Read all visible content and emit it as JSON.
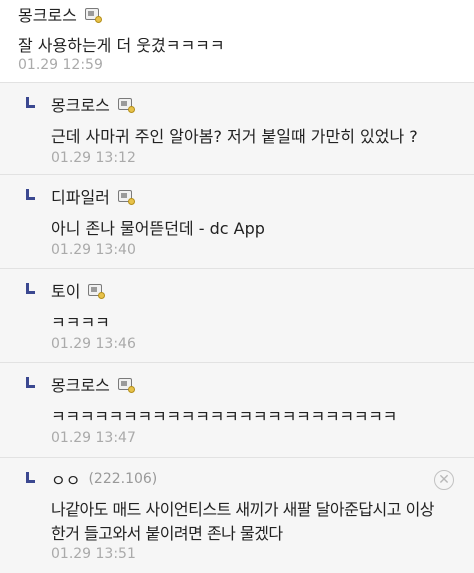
{
  "main_comment": {
    "author": "몽크로스",
    "text": "잘 사용하는게 더 웃겼ㅋㅋㅋㅋ",
    "time": "01.29 12:59"
  },
  "replies": [
    {
      "author": "몽크로스",
      "ip": "",
      "text": "근데 사마귀 주인 알아봄? 저거 붙일때 가만히 있었나 ?",
      "text2": "",
      "time": "01.29 13:12"
    },
    {
      "author": "디파일러",
      "ip": "",
      "text": "아니 존나 물어뜯던데 - dc App",
      "text2": "",
      "time": "01.29 13:40"
    },
    {
      "author": "토이",
      "ip": "",
      "text": "ㅋㅋㅋㅋ",
      "text2": "",
      "time": "01.29 13:46"
    },
    {
      "author": "몽크로스",
      "ip": "",
      "text": "ㅋㅋㅋㅋㅋㅋㅋㅋㅋㅋㅋㅋㅋㅋㅋㅋㅋㅋㅋㅋㅋㅋㅋㅋ",
      "text2": "",
      "time": "01.29 13:47"
    },
    {
      "author": "ㅇㅇ",
      "ip": "(222.106)",
      "text": "나같아도 매드 사이언티스트 새끼가 새팔 달아준답시고 이상",
      "text2": "한거 들고와서 붙이려면 존나 물겠다",
      "time": "01.29 13:51"
    }
  ],
  "icons": {
    "badge": "gallog-badge-icon",
    "delete": "delete-x-icon"
  },
  "colors": {
    "reply_background": "#f6f6f6",
    "reply_marker": "#3b4890",
    "timestamp": "#aaaaaa"
  }
}
